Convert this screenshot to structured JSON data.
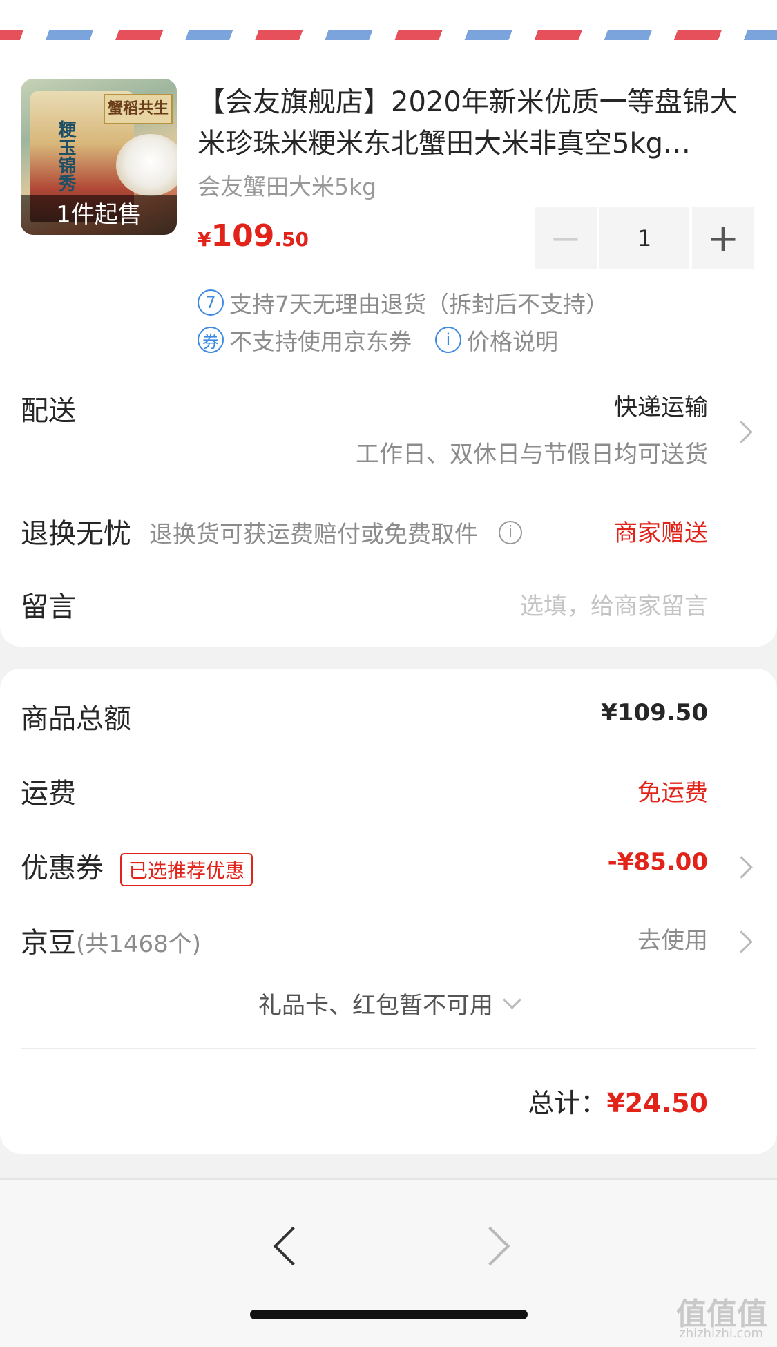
{
  "product": {
    "thumb_badge": "1件起售",
    "thumb_brand": "蟹稻共生",
    "thumb_vertical": "粳玉锦秀",
    "title": "【会友旗舰店】2020年新米优质一等盘锦大米珍珠米粳米东北蟹田大米非真空5kg…",
    "spec": "会友蟹田大米5kg",
    "price_currency": "¥",
    "price_int": "109",
    "price_dec": ".50",
    "quantity": "1",
    "minus": "−",
    "plus": "+",
    "service_1_icon": "7",
    "service_1": "支持7天无理由退货（拆封后不支持）",
    "service_2_icon": "券",
    "service_2": "不支持使用京东券",
    "service_3_icon": "i",
    "service_3": "价格说明"
  },
  "delivery": {
    "label": "配送",
    "method": "快递运输",
    "note": "工作日、双休日与节假日均可送货"
  },
  "returns": {
    "label": "退换无忧",
    "note": "退换货可获运费赔付或免费取件",
    "value": "商家赠送"
  },
  "message": {
    "label": "留言",
    "placeholder": "选填，给商家留言"
  },
  "summary": {
    "goods_total_label": "商品总额",
    "goods_total_value": "¥109.50",
    "shipping_label": "运费",
    "shipping_value": "免运费",
    "coupon_label": "优惠券",
    "coupon_tag": "已选推荐优惠",
    "coupon_value": "-¥85.00",
    "beans_label": "京豆",
    "beans_count": "(共1468个)",
    "beans_action": "去使用",
    "unavailable": "礼品卡、红包暂不可用",
    "total_label": "总计：",
    "total_value": "¥24.50"
  },
  "watermark": {
    "text": "值值值",
    "sub": "zhizhizhi.com"
  },
  "colors": {
    "accent_red": "#e2231a",
    "service_blue": "#3d8ae0"
  }
}
